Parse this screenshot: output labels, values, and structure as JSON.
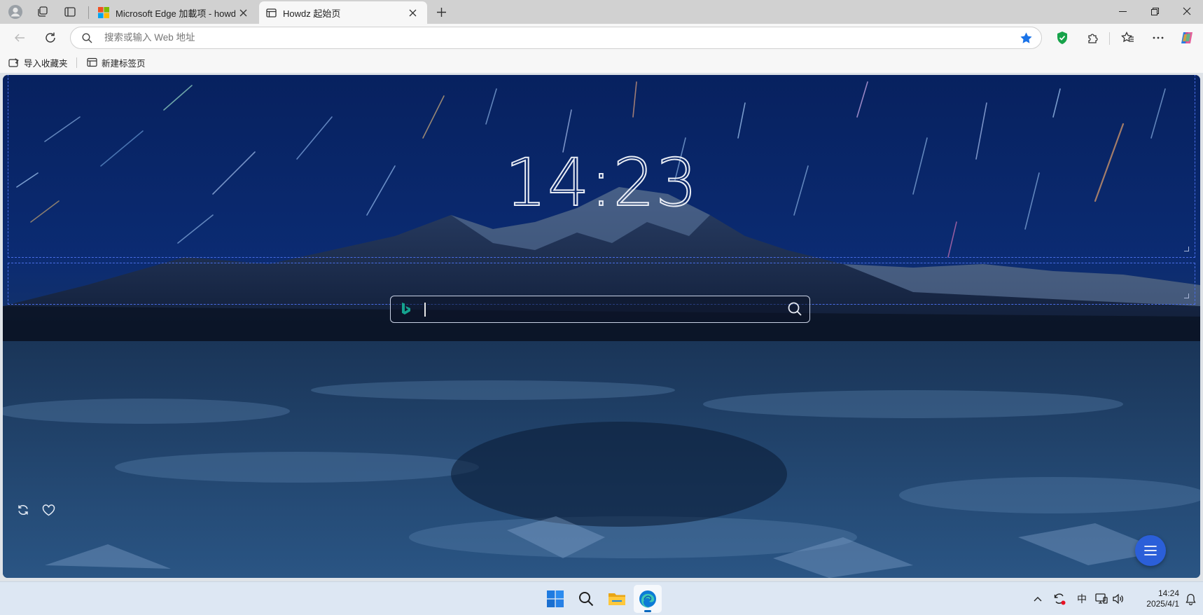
{
  "browser": {
    "tabs": [
      {
        "title": "Microsoft Edge 加載项 - howdz起",
        "active": false
      },
      {
        "title": "Howdz 起始页",
        "active": true
      }
    ],
    "address_placeholder": "搜索或输入 Web 地址",
    "address_value": ""
  },
  "favorites_bar": {
    "items": [
      {
        "label": "导入收藏夹"
      },
      {
        "label": "新建标签页"
      }
    ]
  },
  "page": {
    "clock": "14:23",
    "search": {
      "engine": "Bing",
      "value": ""
    },
    "accent_color": "#2b5fd9",
    "frame_color": "#4a6ee8"
  },
  "taskbar": {
    "apps": [
      "start-icon",
      "search-icon",
      "file-explorer-icon",
      "edge-icon"
    ],
    "ime": "中",
    "time": "14:24",
    "date": "2025/4/1"
  }
}
